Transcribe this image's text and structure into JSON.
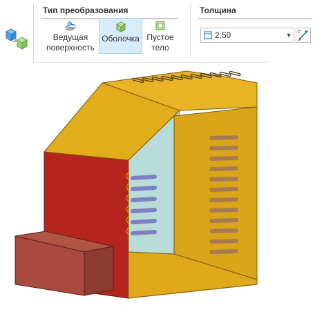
{
  "ribbon": {
    "left_icon": "shell-feature-icon",
    "transform_type_group": {
      "title": "Тип преобразования",
      "buttons": [
        {
          "id": "leading-surface",
          "label_line1": "Ведущая",
          "label_line2": "поверхность",
          "icon": "leading-surface-icon",
          "selected": false
        },
        {
          "id": "shell",
          "label_line1": "Оболочка",
          "label_line2": "",
          "icon": "shell-icon",
          "selected": true
        },
        {
          "id": "hollow-body",
          "label_line1": "Пустое",
          "label_line2": "тело",
          "icon": "hollow-body-icon",
          "selected": false
        }
      ]
    },
    "thickness_group": {
      "title": "Толщина",
      "value": "2.50",
      "dropdown_icon": "chevron-down-icon",
      "measure_icon": "measure-icon"
    }
  },
  "colors": {
    "active_bg": "#d9ecfb",
    "active_border": "#a8cfee",
    "body_yellow": "#e2ad1a",
    "body_red": "#b5251e",
    "inner_teal": "#b8ddd8",
    "slot_purple": "#7e7fc0",
    "slot_brown": "#a67b52",
    "box_red": "#a84a3e"
  }
}
